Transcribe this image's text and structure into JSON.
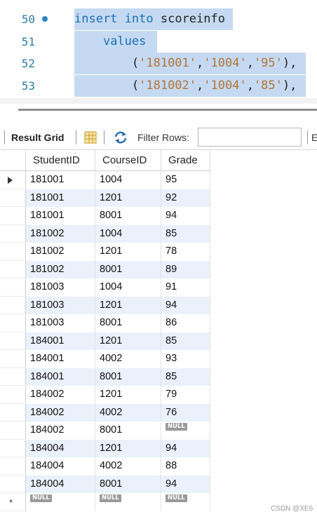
{
  "editor": {
    "lines": [
      {
        "num": "50",
        "breakpoint": true,
        "tokens": [
          {
            "t": "insert",
            "c": "kw"
          },
          {
            "t": " ",
            "c": "punc"
          },
          {
            "t": "into",
            "c": "kw"
          },
          {
            "t": " scoreinfo",
            "c": "punc"
          }
        ]
      },
      {
        "num": "51",
        "breakpoint": false,
        "tokens": [
          {
            "t": "    ",
            "c": "punc"
          },
          {
            "t": "values",
            "c": "kw"
          }
        ]
      },
      {
        "num": "52",
        "breakpoint": false,
        "tokens": [
          {
            "t": "        (",
            "c": "punc"
          },
          {
            "t": "'181001'",
            "c": "str"
          },
          {
            "t": ",",
            "c": "punc"
          },
          {
            "t": "'1004'",
            "c": "str"
          },
          {
            "t": ",",
            "c": "punc"
          },
          {
            "t": "'95'",
            "c": "str"
          },
          {
            "t": "),",
            "c": "punc"
          }
        ]
      },
      {
        "num": "53",
        "breakpoint": false,
        "tokens": [
          {
            "t": "        (",
            "c": "punc"
          },
          {
            "t": "'181002'",
            "c": "str"
          },
          {
            "t": ",",
            "c": "punc"
          },
          {
            "t": "'1004'",
            "c": "str"
          },
          {
            "t": ",",
            "c": "punc"
          },
          {
            "t": "'85'",
            "c": "str"
          },
          {
            "t": "),",
            "c": "punc"
          }
        ]
      }
    ]
  },
  "toolbar": {
    "title": "Result Grid",
    "filter_label": "Filter Rows:",
    "filter_value": "",
    "more_label": "E"
  },
  "grid": {
    "columns": [
      "StudentID",
      "CourseID",
      "Grade"
    ],
    "rows": [
      [
        "181001",
        "1004",
        "95"
      ],
      [
        "181001",
        "1201",
        "92"
      ],
      [
        "181001",
        "8001",
        "94"
      ],
      [
        "181002",
        "1004",
        "85"
      ],
      [
        "181002",
        "1201",
        "78"
      ],
      [
        "181002",
        "8001",
        "89"
      ],
      [
        "181003",
        "1004",
        "91"
      ],
      [
        "181003",
        "1201",
        "94"
      ],
      [
        "181003",
        "8001",
        "86"
      ],
      [
        "184001",
        "1201",
        "85"
      ],
      [
        "184001",
        "4002",
        "93"
      ],
      [
        "184001",
        "8001",
        "85"
      ],
      [
        "184002",
        "1201",
        "79"
      ],
      [
        "184002",
        "4002",
        "76"
      ],
      [
        "184002",
        "8001",
        "NULL"
      ],
      [
        "184004",
        "1201",
        "94"
      ],
      [
        "184004",
        "4002",
        "88"
      ],
      [
        "184004",
        "8001",
        "94"
      ]
    ],
    "new_row": [
      "NULL",
      "NULL",
      "NULL"
    ],
    "current_row_marker": "▶",
    "new_row_marker": "*"
  },
  "watermark": "CSDN @XE6",
  "colors": {
    "keyword": "#1d6fb3",
    "string": "#b5753a",
    "selection": "#c5daf2",
    "alt_row": "#eaf1fb"
  }
}
